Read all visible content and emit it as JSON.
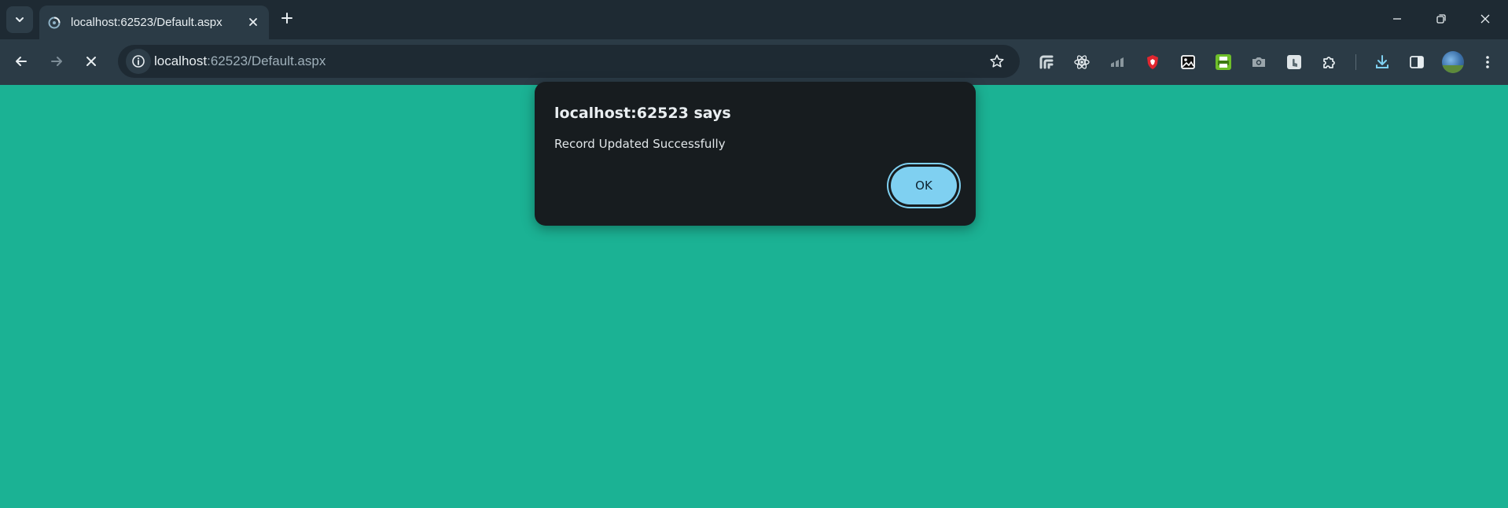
{
  "browser": {
    "tab": {
      "title": "localhost:62523/Default.aspx",
      "favicon": "loading-spinner-icon"
    },
    "omnibox": {
      "host": "localhost",
      "rest": ":62523/Default.aspx"
    },
    "extensions": [
      "feedly-icon",
      "react-icon",
      "chart-icon",
      "brave-shield-icon",
      "image-icon",
      "printer-icon",
      "camera-icon",
      "touch-icon",
      "puzzle-icon"
    ]
  },
  "page": {
    "background_color": "#1bb294"
  },
  "dialog": {
    "title": "localhost:62523 says",
    "message": "Record Updated Successfully",
    "ok_label": "OK"
  },
  "colors": {
    "tabstrip": "#1e2a33",
    "toolbar": "#2b3b46",
    "dialog_bg": "#171c1f",
    "ok_button": "#7fd0f1"
  }
}
